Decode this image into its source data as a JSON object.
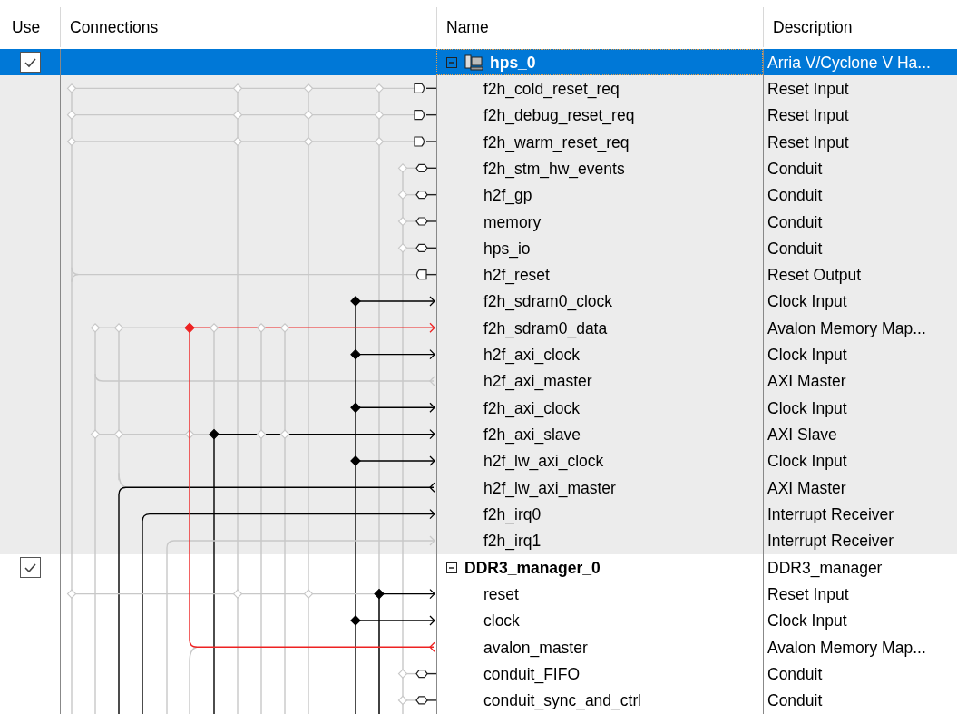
{
  "columns": [
    "Use",
    "Connections",
    "Name",
    "Description"
  ],
  "components": [
    {
      "name": "hps_0",
      "description": "Arria V/Cyclone V Ha...",
      "use": true,
      "selected": true,
      "focused": true,
      "expanded": true,
      "kind": "processor",
      "children": [
        {
          "name": "f2h_cold_reset_req",
          "description": "Reset Input"
        },
        {
          "name": "f2h_debug_reset_req",
          "description": "Reset Input"
        },
        {
          "name": "f2h_warm_reset_req",
          "description": "Reset Input"
        },
        {
          "name": "f2h_stm_hw_events",
          "description": "Conduit"
        },
        {
          "name": "h2f_gp",
          "description": "Conduit"
        },
        {
          "name": "memory",
          "description": "Conduit"
        },
        {
          "name": "hps_io",
          "description": "Conduit"
        },
        {
          "name": "h2f_reset",
          "description": "Reset Output"
        },
        {
          "name": "f2h_sdram0_clock",
          "description": "Clock Input"
        },
        {
          "name": "f2h_sdram0_data",
          "description": "Avalon Memory Map..."
        },
        {
          "name": "h2f_axi_clock",
          "description": "Clock Input"
        },
        {
          "name": "h2f_axi_master",
          "description": "AXI Master"
        },
        {
          "name": "f2h_axi_clock",
          "description": "Clock Input"
        },
        {
          "name": "f2h_axi_slave",
          "description": "AXI Slave"
        },
        {
          "name": "h2f_lw_axi_clock",
          "description": "Clock Input"
        },
        {
          "name": "h2f_lw_axi_master",
          "description": "AXI Master"
        },
        {
          "name": "f2h_irq0",
          "description": "Interrupt Receiver"
        },
        {
          "name": "f2h_irq1",
          "description": "Interrupt Receiver"
        }
      ]
    },
    {
      "name": "DDR3_manager_0",
      "description": "DDR3_manager",
      "use": true,
      "selected": false,
      "focused": false,
      "expanded": true,
      "kind": "module",
      "children": [
        {
          "name": "reset",
          "description": "Reset Input"
        },
        {
          "name": "clock",
          "description": "Clock Input"
        },
        {
          "name": "avalon_master",
          "description": "Avalon Memory Map..."
        },
        {
          "name": "conduit_FIFO",
          "description": "Conduit"
        },
        {
          "name": "conduit_sync_and_ctrl",
          "description": "Conduit"
        }
      ]
    }
  ]
}
